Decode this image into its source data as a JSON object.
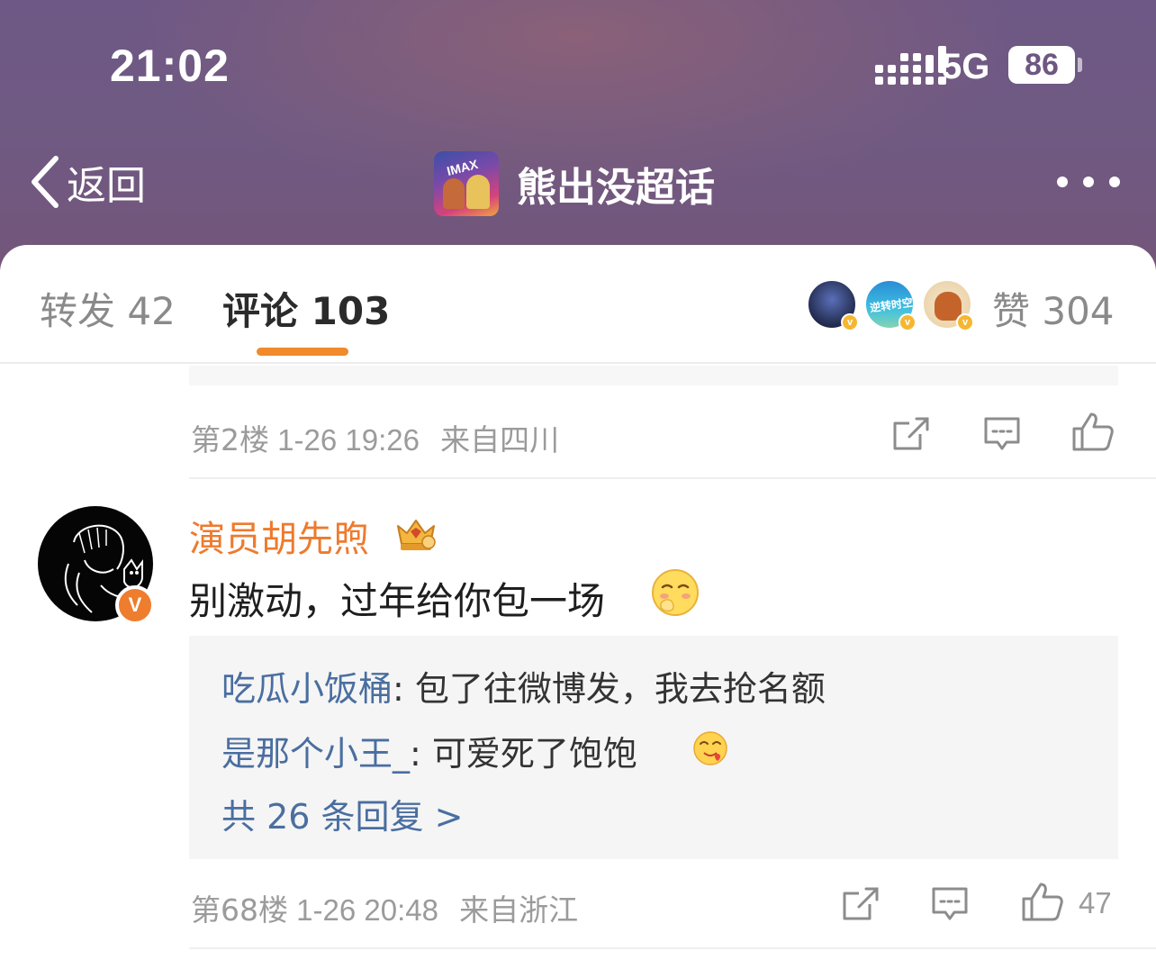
{
  "status_bar": {
    "time": "21:02",
    "network": "5G",
    "battery": "86"
  },
  "nav": {
    "back_label": "返回",
    "title": "熊出没超话",
    "thumb_text": "IMAX"
  },
  "tabs": {
    "repost": "转发 42",
    "comment": "评论 103",
    "like": "赞 304",
    "liker_avatars": [
      "liker-avatar-1",
      "liker-avatar-2",
      "liker-avatar-3"
    ],
    "liker2_text": "逆转时空",
    "active_color": "#f08a2a"
  },
  "comments": [
    {
      "floor": "第2楼",
      "time": "1-26 19:26",
      "location": "来自四川",
      "likes": ""
    },
    {
      "author": "演员胡先煦",
      "verified_badge": "V",
      "text": "别激动，过年给你包一场",
      "replies": [
        {
          "name": "吃瓜小饭桶",
          "text": ": 包了往微博发，我去抢名额"
        },
        {
          "name": "是那个小王_",
          "text": ": 可爱死了饱饱"
        }
      ],
      "more_replies": "共 26 条回复 >",
      "floor": "第68楼",
      "time": "1-26 20:48",
      "location": "来自浙江",
      "likes": "47"
    }
  ],
  "colors": {
    "author_name": "#ee7a2d",
    "reply_name": "#4a6ea0",
    "meta_text": "#9b9b9b"
  }
}
